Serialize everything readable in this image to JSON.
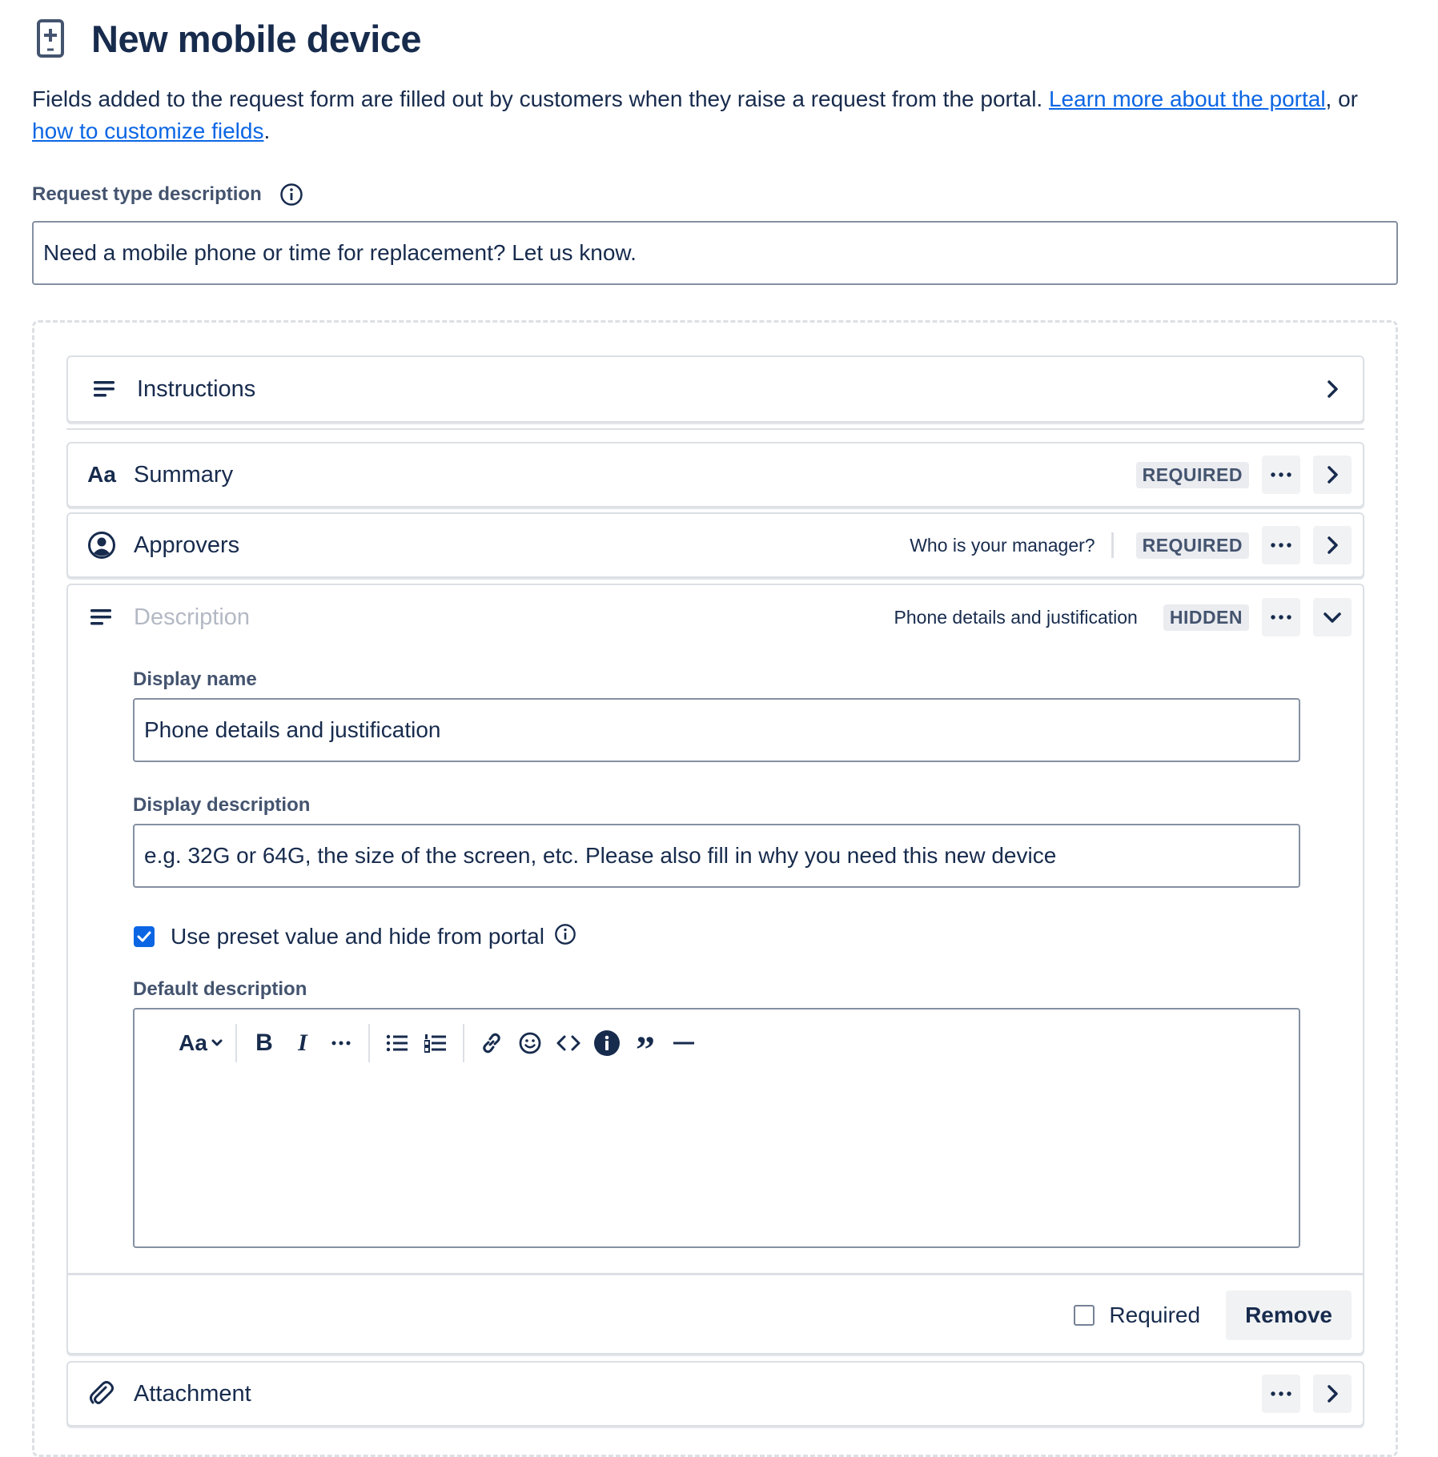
{
  "header": {
    "title": "New mobile device"
  },
  "intro": {
    "text": "Fields added to the request form are filled out by customers when they raise a request from the portal. ",
    "link1": "Learn more about the portal",
    "mid": ", or ",
    "link2": "how to customize fields",
    "end": "."
  },
  "request_type": {
    "label": "Request type description",
    "value": "Need a mobile phone or time for replacement? Let us know."
  },
  "fields": {
    "instructions": {
      "label": "Instructions"
    },
    "summary": {
      "label": "Summary",
      "badge": "REQUIRED"
    },
    "approvers": {
      "label": "Approvers",
      "hint": "Who is your manager?",
      "badge": "REQUIRED"
    },
    "description": {
      "label": "Description",
      "hint": "Phone details and justification",
      "badge": "HIDDEN",
      "display_name_label": "Display name",
      "display_name_value": "Phone details and justification",
      "display_description_label": "Display description",
      "display_description_value": "e.g. 32G or 64G, the size of the screen, etc. Please also fill in why you need this new device",
      "preset_label": "Use preset value and hide from portal",
      "default_description_label": "Default description",
      "toolbar_text_style": "Aa",
      "required_label": "Required",
      "remove_label": "Remove"
    },
    "attachment": {
      "label": "Attachment"
    }
  },
  "colors": {
    "text": "#172B4D",
    "link": "#0C66E4",
    "border": "#DCDFE4",
    "input_border": "#8590A2",
    "checkbox": "#0C66E4"
  }
}
